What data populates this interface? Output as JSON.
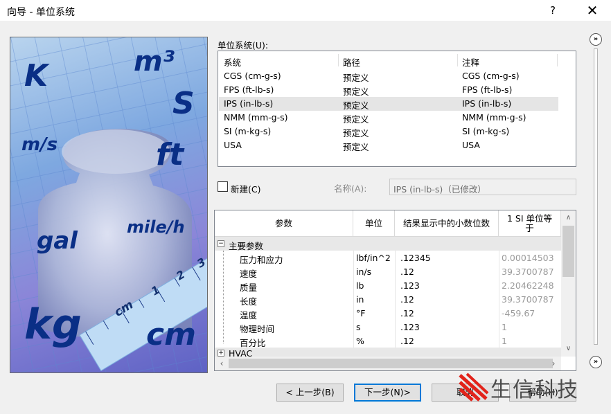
{
  "window": {
    "title": "向导 - 单位系统",
    "help_glyph": "?",
    "close_glyph": "✕"
  },
  "hero": {
    "words": [
      "K",
      "m³",
      "S",
      "m/s",
      "ft",
      "mile/h",
      "gal",
      "kg",
      "cm",
      "cm"
    ],
    "ruler_numbers": [
      "1",
      "2",
      "3"
    ]
  },
  "units_label": "单位系统(U):",
  "unit_list": {
    "columns": [
      "系统",
      "路径",
      "注释"
    ],
    "rows": [
      {
        "system": "CGS (cm-g-s)",
        "path": "预定义",
        "note": "CGS (cm-g-s)"
      },
      {
        "system": "FPS (ft-lb-s)",
        "path": "预定义",
        "note": "FPS (ft-lb-s)"
      },
      {
        "system": "IPS (in-lb-s)",
        "path": "预定义",
        "note": "IPS (in-lb-s)"
      },
      {
        "system": "NMM (mm-g-s)",
        "path": "预定义",
        "note": "NMM (mm-g-s)"
      },
      {
        "system": "SI (m-kg-s)",
        "path": "预定义",
        "note": "SI (m-kg-s)"
      },
      {
        "system": "USA",
        "path": "预定义",
        "note": "USA"
      }
    ],
    "selected_index": 2
  },
  "new_checkbox_label": "新建(C)",
  "name_label": "名称(A):",
  "name_value": "IPS (in-lb-s)（已修改）",
  "param_grid": {
    "columns": [
      "参数",
      "单位",
      "结果显示中的小数位数",
      "1 SI 单位等于"
    ],
    "group": "主要参数",
    "group_expander": "−",
    "rows": [
      {
        "param": "压力和应力",
        "unit": "lbf/in^2",
        "decimals": ".12345",
        "si": "0.00014503"
      },
      {
        "param": "速度",
        "unit": "in/s",
        "decimals": ".12",
        "si": "39.3700787"
      },
      {
        "param": "质量",
        "unit": "lb",
        "decimals": ".123",
        "si": "2.20462248"
      },
      {
        "param": "长度",
        "unit": "in",
        "decimals": ".12",
        "si": "39.3700787"
      },
      {
        "param": "温度",
        "unit": "°F",
        "decimals": ".12",
        "si": "-459.67"
      },
      {
        "param": "物理时间",
        "unit": "s",
        "decimals": ".123",
        "si": "1"
      },
      {
        "param": "百分比",
        "unit": "%",
        "decimals": ".12",
        "si": "1"
      }
    ],
    "next_group": "HVAC",
    "next_group_expander": "+"
  },
  "nav": {
    "top": "»",
    "bottom": "»"
  },
  "buttons": {
    "back": "< 上一步(B)",
    "next": "下一步(N)>",
    "cancel": "取消",
    "help": "帮助(H)"
  },
  "watermark": "生信科技"
}
